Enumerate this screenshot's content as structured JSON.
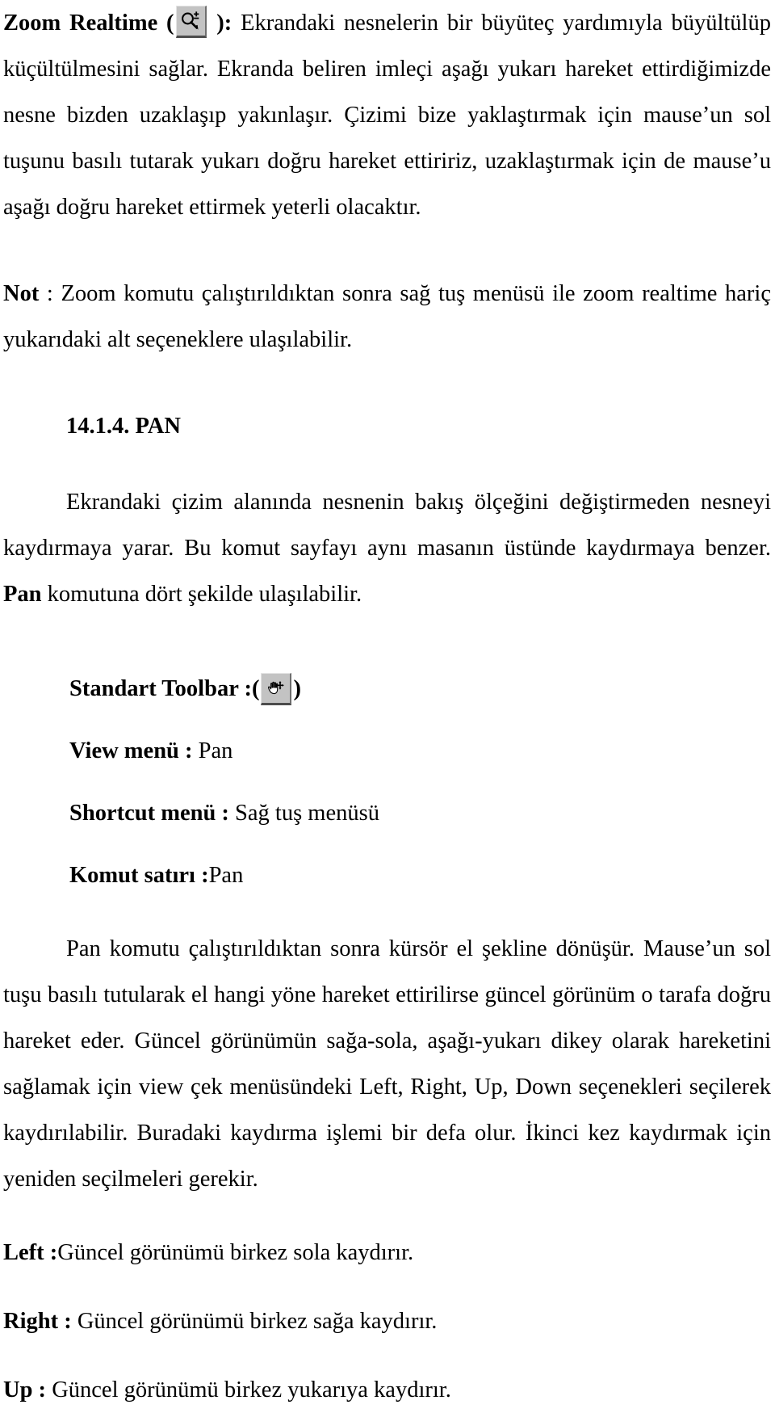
{
  "document": {
    "language": "tr",
    "colors": {
      "text": "#000000",
      "background": "#ffffff",
      "button_face": "#c3c3c3",
      "button_shadow": "#4c4c4c",
      "button_highlight": "#e4e4e4"
    }
  },
  "blocks": {
    "zoom_realtime": {
      "term": "Zoom Realtime",
      "open_paren": " (",
      "icon_name": "zoom-realtime-icon",
      "close_paren": " )",
      "colon": ":",
      "body": " Ekrandaki nesnelerin bir büyüteç yardımıyla büyültülüp küçültülmesini sağlar. Ekranda beliren imleçi aşağı yukarı hareket ettirdiğimizde nesne bizden uzaklaşıp yakınlaşır. Çizimi bize yaklaştırmak için mause’un sol tuşunu basılı tutarak yukarı doğru hareket ettiririz, uzaklaştırmak için de mause’u aşağı doğru hareket ettirmek yeterli olacaktır."
    },
    "note": {
      "label": "Not",
      "body": " : Zoom komutu çalıştırıldıktan sonra sağ tuş menüsü ile zoom realtime hariç yukarıdaki alt seçeneklere ulaşılabilir."
    },
    "section": {
      "number": "14.1.4.",
      "title": "PAN",
      "heading_full": "14.1.4. PAN"
    },
    "pan_intro": {
      "body": "Ekrandaki çizim alanında nesnenin bakış ölçeğini değiştirmeden nesneyi kaydırmaya yarar. Bu komut sayfayı aynı masanın üstünde kaydırmaya benzer. ",
      "bold_term": "Pan",
      "tail": " komutuna dört şekilde ulaşılabilir."
    },
    "access_methods": [
      {
        "label": "Standart Toolbar :(",
        "icon_name": "pan-hand-icon",
        "label_after": ")",
        "value": "",
        "has_icon": true
      },
      {
        "label": "View menü : ",
        "value": "Pan",
        "has_icon": false
      },
      {
        "label": "Shortcut menü : ",
        "value": "Sağ tuş menüsü",
        "has_icon": false
      },
      {
        "label": "Komut satırı :",
        "value": "Pan",
        "has_icon": false
      }
    ],
    "pan_description": {
      "body": "Pan komutu çalıştırıldıktan sonra kürsör el şekline dönüşür. Mause’un sol tuşu basılı tutularak el hangi yöne hareket ettirilirse güncel görünüm o tarafa doğru hareket eder. Güncel görünümün sağa-sola, aşağı-yukarı dikey olarak hareketini sağlamak için view çek menüsündeki Left, Right, Up, Down seçenekleri seçilerek kaydırılabilir. Buradaki kaydırma işlemi bir defa olur. İkinci kez kaydırmak için yeniden seçilmeleri gerekir."
    },
    "direction_options": [
      {
        "term": "Left :",
        "desc": "Güncel görünümü birkez sola kaydırır."
      },
      {
        "term": "Right : ",
        "desc": "Güncel görünümü birkez sağa kaydırır."
      },
      {
        "term": "Up : ",
        "desc": "Güncel görünümü birkez yukarıya kaydırır."
      }
    ]
  }
}
